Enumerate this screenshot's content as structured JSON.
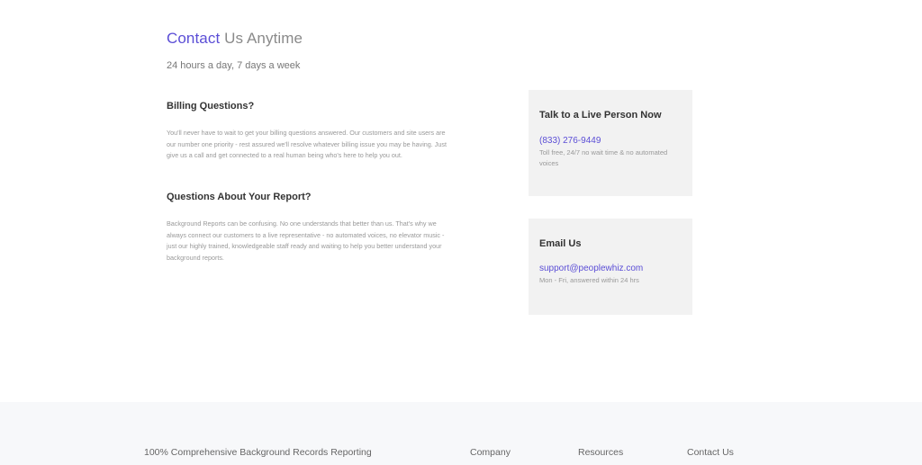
{
  "hero": {
    "title_accent": "Contact",
    "title_rest": " Us Anytime",
    "subtitle": "24 hours a day, 7 days a week"
  },
  "faq": [
    {
      "heading": "Billing Questions?",
      "body": "You'll never have to wait to get your billing questions answered. Our customers and site users are our number one priority - rest assured we'll resolve whatever billing issue you may be having. Just give us a call and get connected to a real human being who's here to help you out."
    },
    {
      "heading": "Questions About Your Report?",
      "body": "Background Reports can be confusing. No one understands that better than us. That's why we always connect our customers to a live representative - no automated voices, no elevator music - just our highly trained, knowledgeable staff ready and waiting to help you better understand your background reports."
    }
  ],
  "cards": [
    {
      "heading": "Talk to a Live Person Now",
      "link": "(833) 276-9449",
      "note": "Toll free, 24/7 no wait time & no automated voices"
    },
    {
      "heading": "Email Us",
      "link": "support@peoplewhiz.com",
      "note": "Mon - Fri, answered within 24 hrs"
    }
  ],
  "footer": {
    "brand": "100% Comprehensive Background Records Reporting",
    "company": "Company",
    "resources": "Resources",
    "contact": "Contact Us"
  },
  "colors": {
    "accent": "#5b4ed6",
    "card_bg": "#f2f2f2",
    "footer_bg": "#f7f8fa"
  }
}
